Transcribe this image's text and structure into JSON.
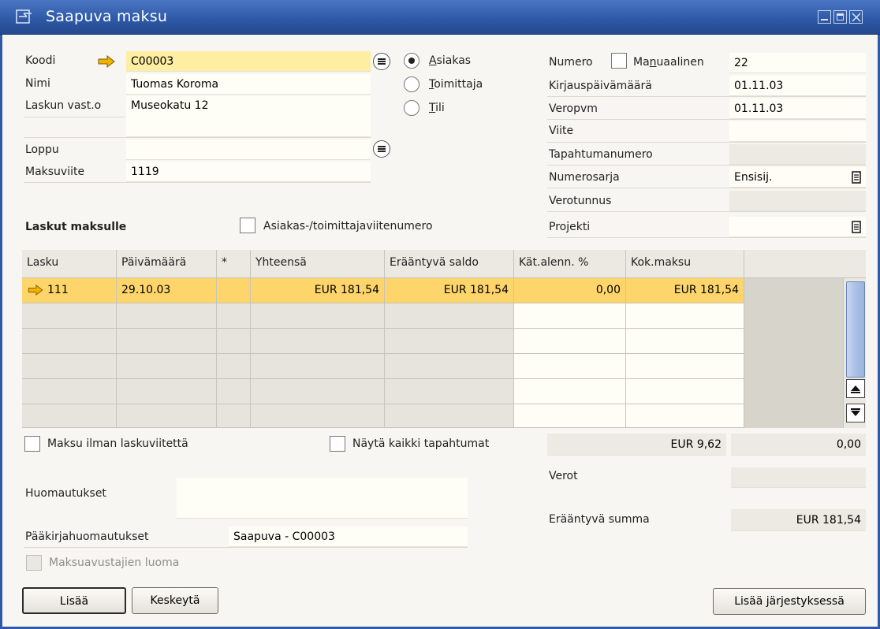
{
  "window": {
    "title": "Saapuva maksu",
    "icon": "form-icon",
    "controls": [
      "minimize-icon",
      "maximize-icon",
      "close-icon"
    ]
  },
  "header_left": {
    "code_label": "Koodi",
    "code_value": "C00003",
    "name_label": "Nimi",
    "name_value": "Tuomas Koroma",
    "address_label": "Laskun vast.o",
    "address_value": "Museokatu 12",
    "end_label": "Loppu",
    "end_value": "",
    "payref_label": "Maksuviite",
    "payref_value": "1119"
  },
  "type_radio": {
    "customer": "Asiakas",
    "customer_key": "A",
    "customer_rest": "siakas",
    "supplier": "Toimittaja",
    "supplier_key": "T",
    "supplier_rest": "oimittaja",
    "account": "Tili",
    "account_key": "T",
    "account_rest": "ili",
    "selected": "Asiakas"
  },
  "header_right": {
    "number_label": "Numero",
    "manual_label": "Manuaalinen",
    "manual_pre": "Ma",
    "manual_key": "n",
    "manual_post": "uaalinen",
    "number_value": "22",
    "posting_date_label": "Kirjauspäivämäärä",
    "posting_date_value": "01.11.03",
    "tax_date_label": "Veropvm",
    "tax_date_value": "01.11.03",
    "reference_label": "Viite",
    "reference_value": "",
    "transaction_label": "Tapahtumanumero",
    "transaction_value": "",
    "series_label": "Numerosarja",
    "series_value": "Ensisij.",
    "taxid_label": "Verotunnus",
    "taxid_value": "",
    "project_label": "Projekti",
    "project_value": ""
  },
  "invoices": {
    "title": "Laskut maksulle",
    "bp_ref_label": "Asiakas-/toimittajaviitenumero",
    "columns": [
      "Lasku",
      "Päivämäärä",
      "*",
      "Yhteensä",
      "Erääntyvä saldo",
      "Kät.alenn. %",
      "Kok.maksu"
    ],
    "rows": [
      {
        "invoice": "111",
        "date": "29.10.03",
        "star": "",
        "total": "EUR 181,54",
        "balance": "EUR 181,54",
        "discount": "0,00",
        "payment": "EUR 181,54"
      }
    ]
  },
  "options": {
    "no_invoice_label": "Maksu ilman laskuviitettä",
    "show_all_label": "Näytä kaikki tapahtumat",
    "wizard_label": "Maksuavustajien luoma"
  },
  "totals": {
    "amount1": "EUR 9,62",
    "amount2": "0,00",
    "taxes_label": "Verot",
    "taxes_value": "",
    "due_label": "Erääntyvä summa",
    "due_value": "EUR 181,54"
  },
  "remarks": {
    "remarks_label": "Huomautukset",
    "remarks_value": "",
    "journal_label": "Pääkirjahuomautukset",
    "journal_value": "Saapuva - C00003"
  },
  "buttons": {
    "add": "Lisää",
    "cancel": "Keskeytä",
    "add_in_sequence": "Lisää järjestyksessä"
  },
  "colors": {
    "titlebar": "#2f5aa8",
    "selected_row": "#fdd56a",
    "highlight_field": "#fdeea2",
    "link_arrow": "#e8a400"
  }
}
